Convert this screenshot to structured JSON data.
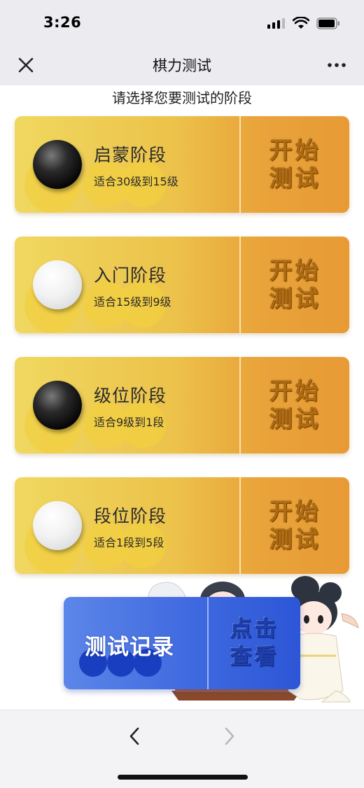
{
  "status_bar": {
    "time": "3:26"
  },
  "nav": {
    "title": "棋力测试"
  },
  "heading": "请选择您要测试的阶段",
  "stages": [
    {
      "title": "启蒙阶段",
      "subtitle": "适合30级到15级",
      "stone": "black",
      "start_label": "开始测试"
    },
    {
      "title": "入门阶段",
      "subtitle": "适合15级到9级",
      "stone": "white",
      "start_label": "开始测试"
    },
    {
      "title": "级位阶段",
      "subtitle": "适合9级到1段",
      "stone": "black",
      "start_label": "开始测试"
    },
    {
      "title": "段位阶段",
      "subtitle": "适合1段到5段",
      "stone": "white",
      "start_label": "开始测试"
    }
  ],
  "record": {
    "title": "测试记录",
    "view_label": "点击查看"
  },
  "colors": {
    "card_gold": "#ecc24a",
    "card_orange": "#e89a35",
    "record_blue": "#3f69df",
    "start_text": "#b06a10"
  },
  "icons": {
    "close": "close-icon",
    "more": "more-dots-icon",
    "back": "chevron-left-icon",
    "forward": "chevron-right-icon"
  }
}
